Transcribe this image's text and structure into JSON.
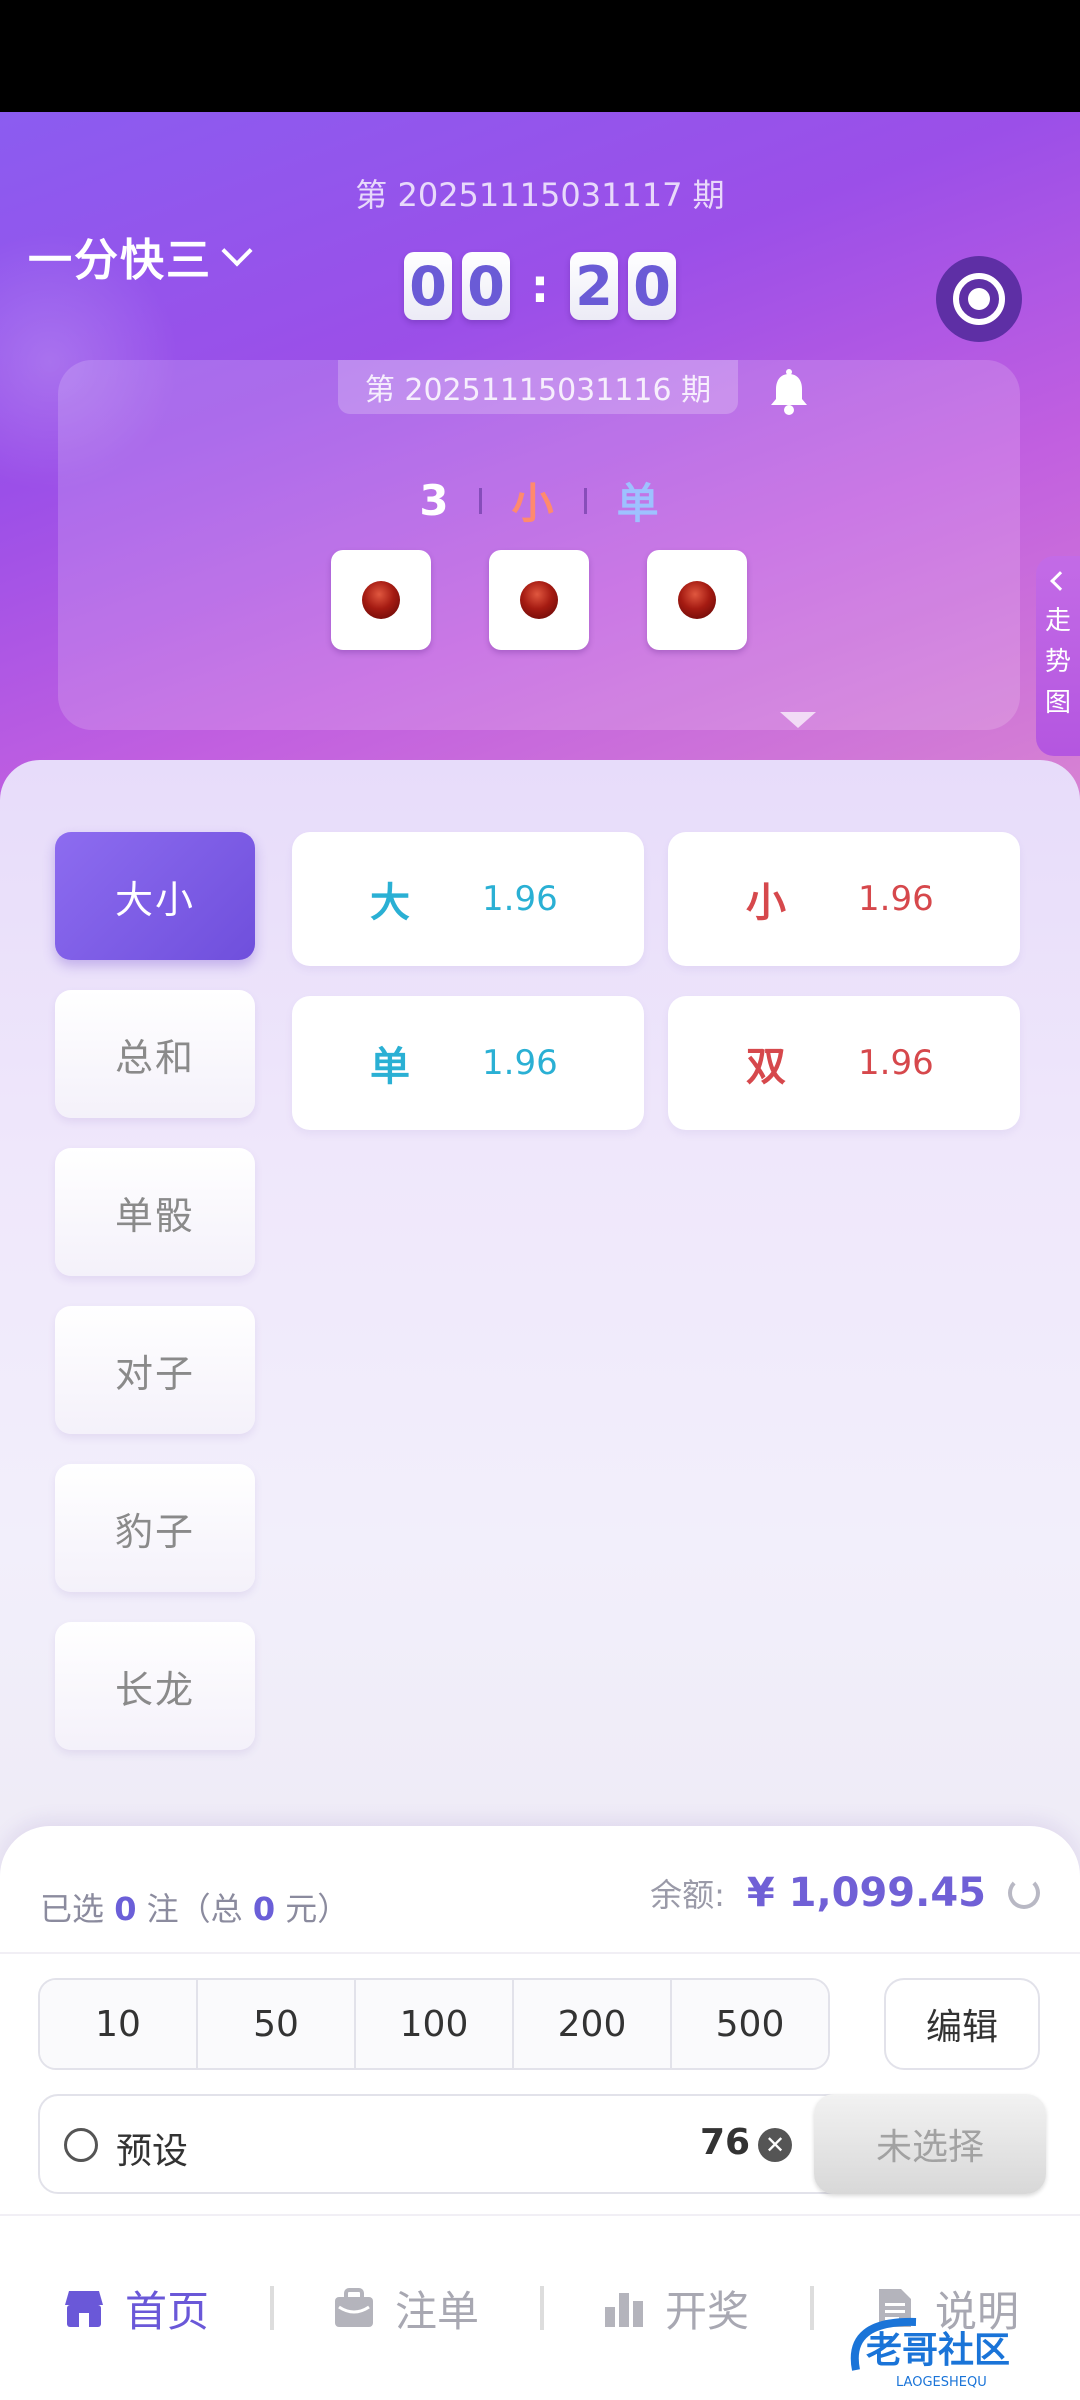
{
  "header": {
    "current_period": "第 20251115031117 期",
    "game_name": "一分快三",
    "countdown": [
      "0",
      "0",
      "2",
      "0"
    ],
    "countdown_sep": ":"
  },
  "last_result": {
    "period": "第 20251115031116 期",
    "sum": "3",
    "size": "小",
    "parity": "单",
    "dice": [
      1,
      1,
      1
    ]
  },
  "trend_tab": {
    "chars": [
      "走",
      "势",
      "图"
    ]
  },
  "categories": [
    {
      "label": "大小",
      "active": true
    },
    {
      "label": "总和",
      "active": false
    },
    {
      "label": "单骰",
      "active": false
    },
    {
      "label": "对子",
      "active": false
    },
    {
      "label": "豹子",
      "active": false
    },
    {
      "label": "长龙",
      "active": false
    }
  ],
  "options": [
    {
      "name": "大",
      "odds": "1.96",
      "color": "#2ab0d4"
    },
    {
      "name": "小",
      "odds": "1.96",
      "color": "#d6484c"
    },
    {
      "name": "单",
      "odds": "1.96",
      "color": "#2ab0d4"
    },
    {
      "name": "双",
      "odds": "1.96",
      "color": "#d6484c"
    }
  ],
  "bet": {
    "selected_prefix": "已选",
    "selected_count": "0",
    "selected_mid": "注（总",
    "selected_total": "0",
    "selected_suffix": "元）",
    "balance_label": "余额:",
    "balance_value": "¥ 1,099.45",
    "chips": [
      "10",
      "50",
      "100",
      "200",
      "500"
    ],
    "edit_label": "编辑",
    "preset_label": "预设",
    "amount": "76",
    "submit_label": "未选择"
  },
  "tabbar": [
    {
      "label": "首页",
      "icon": "home-icon",
      "active": true
    },
    {
      "label": "注单",
      "icon": "orders-icon",
      "active": false
    },
    {
      "label": "开奖",
      "icon": "draw-results-icon",
      "active": false
    },
    {
      "label": "说明",
      "icon": "document-icon",
      "active": false
    }
  ],
  "watermark": {
    "title": "老哥社区",
    "subtitle": "LAOGESHEQU"
  },
  "colors": {
    "accent": "#6a58d8",
    "hero_start": "#8b5cf0",
    "hero_end": "#d884d2",
    "blue_option": "#2ab0d4",
    "red_option": "#d6484c"
  }
}
